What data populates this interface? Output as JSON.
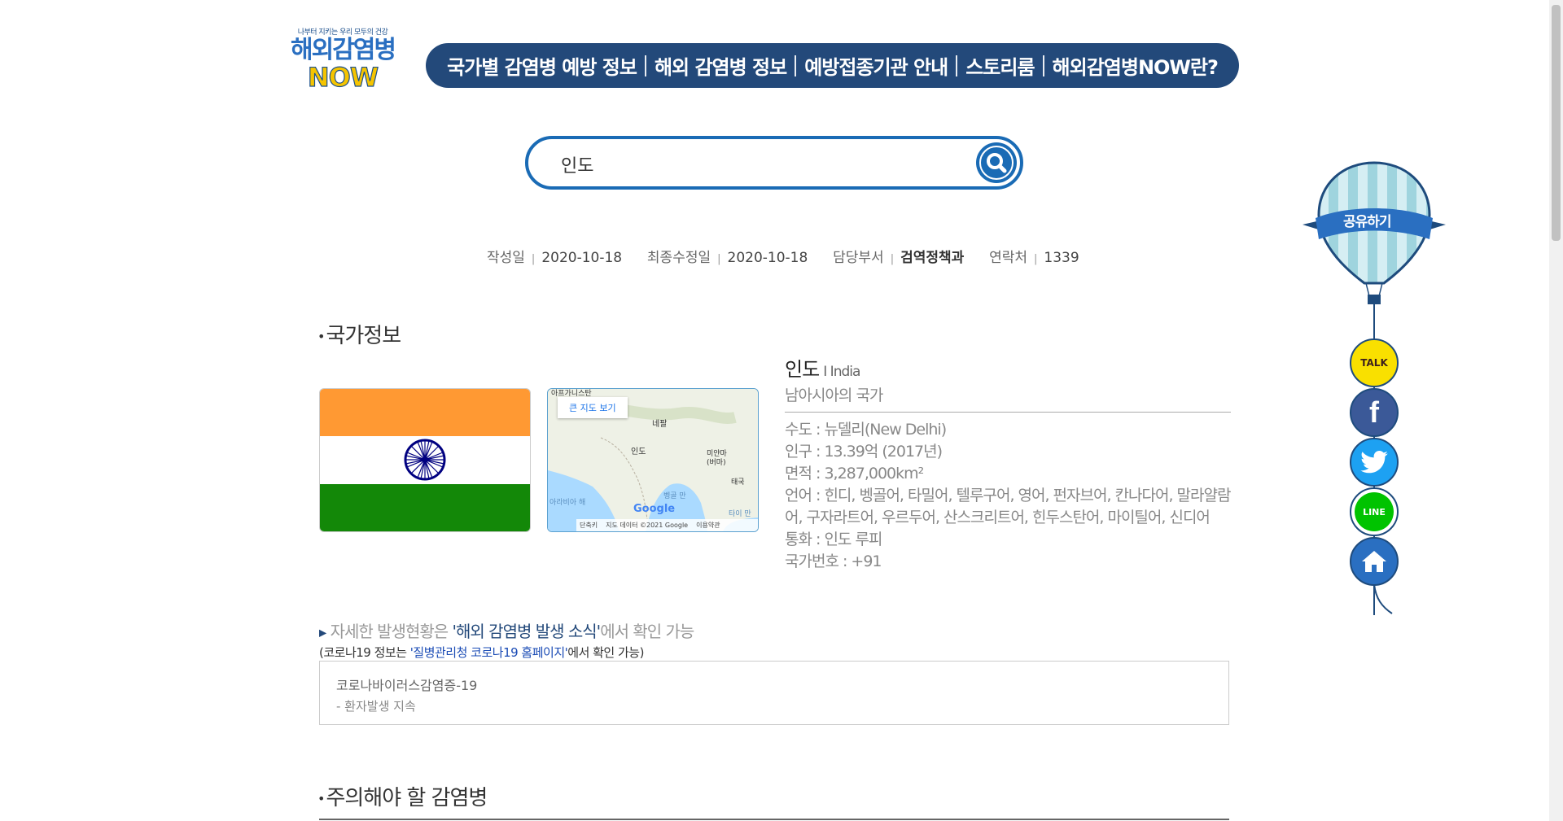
{
  "logo": {
    "tagline": "나부터 지키는 우리 모두의 건강",
    "line1": "해외감염병",
    "line2": "NOW"
  },
  "nav": {
    "items": [
      "국가별 감염병 예방 정보",
      "해외 감염병 정보",
      "예방접종기관 안내",
      "스토리룸",
      "해외감염병NOW란?"
    ]
  },
  "search": {
    "value": "인도"
  },
  "meta": {
    "written_label": "작성일",
    "written": "2020-10-18",
    "modified_label": "최종수정일",
    "modified": "2020-10-18",
    "dept_label": "담당부서",
    "dept": "검역정책과",
    "contact_label": "연락처",
    "contact": "1339"
  },
  "country_section": {
    "title": "국가정보"
  },
  "country": {
    "name": "인도",
    "eng": "I India",
    "region": "남아시아의 국가",
    "rows": [
      "수도 : 뉴델리(New Delhi)",
      "인구 : 13.39억 (2017년)",
      "면적 : 3,287,000km²",
      "언어 : 힌디, 벵골어, 타밀어, 텔루구어, 영어, 펀자브어, 칸나다어, 말라얄람어, 구자라트어, 우르두어, 산스크리트어, 힌두스탄어, 마이틸어, 신디어",
      "통화 : 인도 루피",
      "국가번호 : +91"
    ]
  },
  "map": {
    "big_map_link": "큰 지도 보기",
    "labels": {
      "afg": "아프가니스탄",
      "nepal": "네팔",
      "india": "인도",
      "myanmar": "미얀마\n(버마)",
      "thailand": "태국",
      "bengal": "벵골 만",
      "arabian": "아라비아 해",
      "thai_sea": "타이 만"
    },
    "google": "Google",
    "footer": [
      "단축키",
      "지도 데이터 ©2021 Google",
      "이용약관"
    ]
  },
  "notice": {
    "line1_pre": "자세한 발생현황은 ",
    "line1_link": "'해외 감염병 발생 소식'",
    "line1_post": "에서 확인 가능",
    "line2_pre": "(코로나19 정보는 ",
    "line2_link": "'질병관리청 코로나19 홈페이지'",
    "line2_post": "에서 확인 가능)"
  },
  "outbreak": {
    "disease": "코로나바이러스감염증-19",
    "status": "-  환자발생 지속"
  },
  "caution_section": {
    "title": "주의해야 할 감염병"
  },
  "share": {
    "label": "공유하기",
    "talk": "TALK",
    "facebook": "f",
    "line": "LINE"
  },
  "colors": {
    "navy": "#23497a",
    "blue": "#1a6bb5",
    "flag_saffron": "#ff9933",
    "flag_green": "#138808",
    "chakra": "#000080"
  }
}
